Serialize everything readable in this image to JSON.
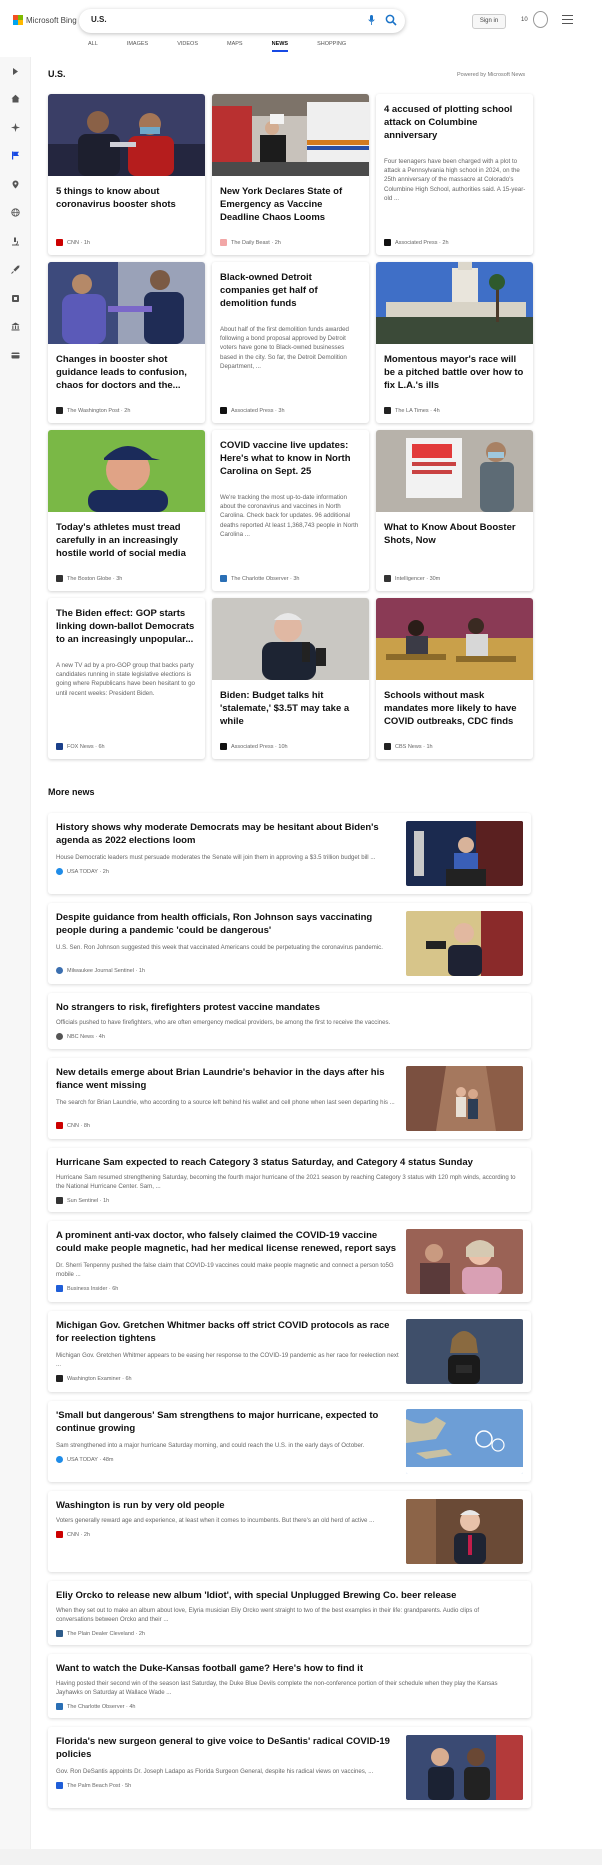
{
  "header": {
    "brand": "Microsoft Bing",
    "search_value": "U.S.",
    "signin_label": "Sign in",
    "points": "10"
  },
  "tabs": [
    "ALL",
    "IMAGES",
    "VIDEOS",
    "MAPS",
    "NEWS",
    "SHOPPING"
  ],
  "active_tab": "NEWS",
  "colors": {
    "accent": "#174ae4",
    "brand_red": "#f25022"
  },
  "section_title": "U.S.",
  "powered_by": "Powered by Microsoft News",
  "cards": [
    {
      "title": "5 things to know about coronavirus booster shots",
      "source": "CNN",
      "age": "1h",
      "desc": "",
      "image": "vaccination-photo"
    },
    {
      "title": "New York Declares State of Emergency as Vaccine Deadline Chaos Looms",
      "source": "The Daily Beast",
      "age": "2h",
      "desc": "",
      "image": "ambulance-photo"
    },
    {
      "title": "4 accused of plotting school attack on Columbine anniversary",
      "source": "Associated Press",
      "age": "2h",
      "desc": "Four teenagers have been charged with a plot to attack a Pennsylvania high school in 2024, on the 25th anniversary of the massacre at Colorado's Columbine High School, authorities said. A 15-year-old ...",
      "image": ""
    },
    {
      "title": "Changes in booster shot guidance leads to confusion, chaos for doctors and the...",
      "source": "The Washington Post",
      "age": "2h",
      "desc": "",
      "image": "booster-shot-photo"
    },
    {
      "title": "Black-owned Detroit companies get half of demolition funds",
      "source": "Associated Press",
      "age": "3h",
      "desc": "About half of the first demolition funds awarded following a bond proposal approved by Detroit voters have gone to Black-owned businesses based in the city. So far, the Detroit Demolition Department, ...",
      "image": ""
    },
    {
      "title": "Momentous mayor's race will be a pitched battle over how to fix L.A.'s ills",
      "source": "The LA Times",
      "age": "4h",
      "desc": "",
      "image": "city-hall-photo"
    },
    {
      "title": "Today's athletes must tread carefully in an increasingly hostile world of social media",
      "source": "The Boston Globe",
      "age": "3h",
      "desc": "",
      "image": "coach-photo"
    },
    {
      "title": "COVID vaccine live updates: Here's what to know in North Carolina on Sept. 25",
      "source": "The Charlotte Observer",
      "age": "3h",
      "desc": "We're tracking the most up-to-date information about the coronavirus and vaccines in North Carolina. Check back for updates. 96 additional deaths reported At least 1,368,743 people in North Carolina ...",
      "image": ""
    },
    {
      "title": "What to Know About Booster Shots, Now",
      "source": "Intelligencer",
      "age": "30m",
      "desc": "",
      "image": "pharmacy-sign-photo"
    },
    {
      "title": "The Biden effect: GOP starts linking down-ballot Democrats to an increasingly unpopular...",
      "source": "FOX News",
      "age": "6h",
      "desc": "A new TV ad by a pro-GOP group that backs party candidates running in state legislative elections is going where Republicans have been hesitant to go until recent weeks: President Biden.",
      "image": ""
    },
    {
      "title": "Biden: Budget talks hit 'stalemate,' $3.5T may take a while",
      "source": "Associated Press",
      "age": "10h",
      "desc": "",
      "image": "biden-photo"
    },
    {
      "title": "Schools without mask mandates more likely to have COVID outbreaks, CDC finds",
      "source": "CBS News",
      "age": "1h",
      "desc": "",
      "image": "classroom-photo"
    }
  ],
  "more_news_title": "More news",
  "more_news": [
    {
      "title": "History shows why moderate Democrats may be hesitant about Biden's agenda as 2022 elections loom",
      "desc": "House Democratic leaders must persuade moderates the Senate will join them in approving a $3.5 trillion budget bill ...",
      "source": "USA TODAY",
      "age": "2h",
      "has_image": true
    },
    {
      "title": "Despite guidance from health officials, Ron Johnson says vaccinating people during a pandemic 'could be dangerous'",
      "desc": "U.S. Sen. Ron Johnson suggested this week that vaccinated Americans could be perpetuating the coronavirus pandemic.",
      "source": "Milwaukee Journal Sentinel",
      "age": "1h",
      "has_image": true
    },
    {
      "title": "No strangers to risk, firefighters protest vaccine mandates",
      "desc": "Officials pushed to have firefighters, who are often emergency medical providers, be among the first to receive the vaccines.",
      "source": "NBC News",
      "age": "4h",
      "has_image": false
    },
    {
      "title": "New details emerge about Brian Laundrie's behavior in the days after his fiance went missing",
      "desc": "The search for Brian Laundrie, who according to a source left behind his wallet and cell phone when last seen departing his ...",
      "source": "CNN",
      "age": "8h",
      "has_image": true
    },
    {
      "title": "Hurricane Sam expected to reach Category 3 status Saturday, and Category 4 status Sunday",
      "desc": "Hurricane Sam resumed strengthening Saturday, becoming the fourth major hurricane of the 2021 season by reaching Category 3 status with 120 mph winds, according to the National Hurricane Center. Sam, ...",
      "source": "Sun Sentinel",
      "age": "1h",
      "has_image": false
    },
    {
      "title": "A prominent anti-vax doctor, who falsely claimed the COVID-19 vaccine could make people magnetic, had her medical license renewed, report says",
      "desc": "Dr. Sherri Tenpenny pushed the false claim that COVID-19 vaccines could make people magnetic and connect a person to5G mobile ...",
      "source": "Business Insider",
      "age": "6h",
      "has_image": true
    },
    {
      "title": "Michigan Gov. Gretchen Whitmer backs off strict COVID protocols as race for reelection tightens",
      "desc": "Michigan Gov. Gretchen Whitmer appears to be easing her response to the COVID-19 pandemic as her race for reelection next ...",
      "source": "Washington Examiner",
      "age": "6h",
      "has_image": true
    },
    {
      "title": "'Small but dangerous' Sam strengthens to major hurricane, expected to continue growing",
      "desc": "Sam strengthened into a major hurricane Saturday morning, and could reach the U.S. in the early days of October.",
      "source": "USA TODAY",
      "age": "48m",
      "has_image": true
    },
    {
      "title": "Washington is run by very old people",
      "desc": "Voters generally reward age and experience, at least when it comes to incumbents. But there's an old herd of active ...",
      "source": "CNN",
      "age": "2h",
      "has_image": true
    },
    {
      "title": "Eliy Orcko to release new album 'Idiot', with special Unplugged Brewing Co. beer release",
      "desc": "When they set out to make an album about love, Elyria musician Eliy Orcko went straight to two of the best examples in their life: grandparents. Audio clips of conversations between Orcko and their ...",
      "source": "The Plain Dealer Cleveland",
      "age": "2h",
      "has_image": false
    },
    {
      "title": "Want to watch the Duke-Kansas football game? Here's how to find it",
      "desc": "Having posted their second win of the season last Saturday, the Duke Blue Devils complete the non-conference portion of their schedule when they play the Kansas Jayhawks on Saturday at Wallace Wade ...",
      "source": "The Charlotte Observer",
      "age": "4h",
      "has_image": false
    },
    {
      "title": "Florida's new surgeon general to give voice to DeSantis' radical COVID-19 policies",
      "desc": "Gov. Ron DeSantis appoints Dr. Joseph Ladapo as Florida Surgeon General, despite his radical views on vaccines, ...",
      "source": "The Palm Beach Post",
      "age": "5h",
      "has_image": true
    }
  ]
}
